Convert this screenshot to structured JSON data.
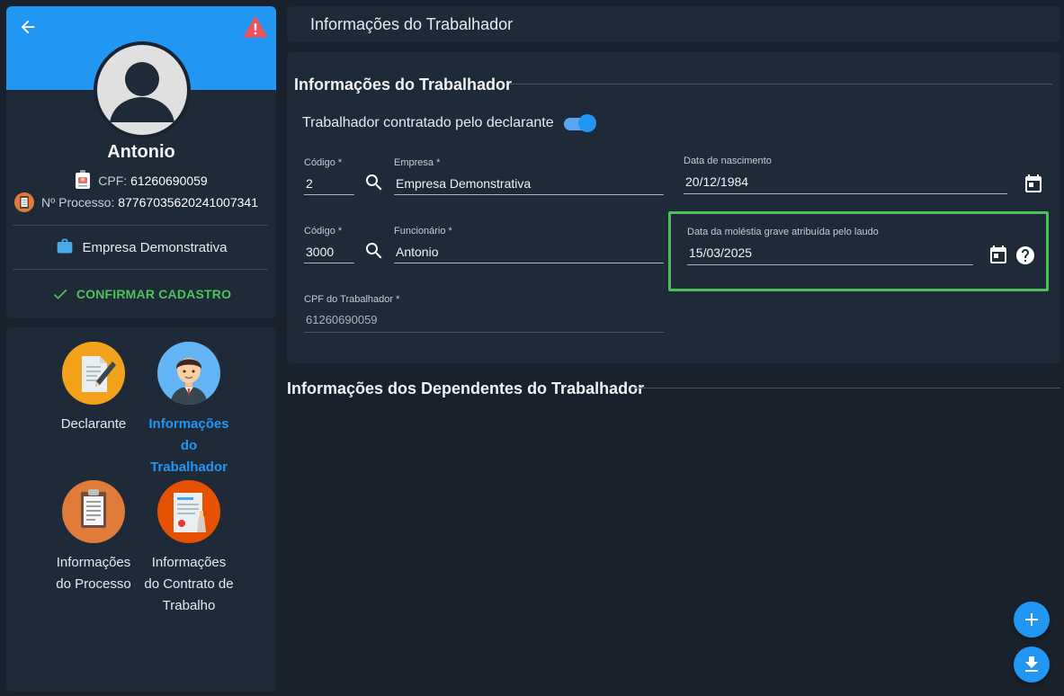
{
  "profile": {
    "name": "Antonio",
    "cpf_label": "CPF:",
    "cpf_value": "61260690059",
    "process_label": "Nº Processo:",
    "process_value": "87767035620241007341",
    "company": "Empresa Demonstrativa",
    "confirm_label": "CONFIRMAR CADASTRO",
    "banner_color": "#2196f3"
  },
  "nav": {
    "items": [
      {
        "label": "Declarante",
        "icon": "declarant-icon",
        "active": false
      },
      {
        "label": "Informações do Trabalhador",
        "icon": "worker-icon",
        "active": true
      },
      {
        "label": "Informações do Processo",
        "icon": "clipboard-icon",
        "active": false
      },
      {
        "label": "Informações do Contrato de Trabalho",
        "icon": "contract-icon",
        "active": false
      }
    ]
  },
  "header": {
    "title": "Informações do Trabalhador"
  },
  "form": {
    "section_title": "Informações do Trabalhador",
    "toggle_label": "Trabalhador contratado pelo declarante",
    "toggle_on": true,
    "codigo_empresa": {
      "label": "Código *",
      "value": "2"
    },
    "empresa": {
      "label": "Empresa *",
      "value": "Empresa Demonstrativa"
    },
    "data_nascimento": {
      "label": "Data de nascimento",
      "value": "20/12/1984"
    },
    "codigo_funcionario": {
      "label": "Código *",
      "value": "3000"
    },
    "funcionario": {
      "label": "Funcionário *",
      "value": "Antonio"
    },
    "data_molestia": {
      "label": "Data da moléstia grave atribuída pelo laudo",
      "value": "15/03/2025"
    },
    "cpf_trabalhador": {
      "label": "CPF do Trabalhador *",
      "value": "61260690059"
    }
  },
  "dependents": {
    "section_title": "Informações dos Dependentes do Trabalhador"
  },
  "colors": {
    "accent": "#2196f3",
    "success": "#4cc45b",
    "highlight": "#4cbf56",
    "warning": "#e53935"
  }
}
